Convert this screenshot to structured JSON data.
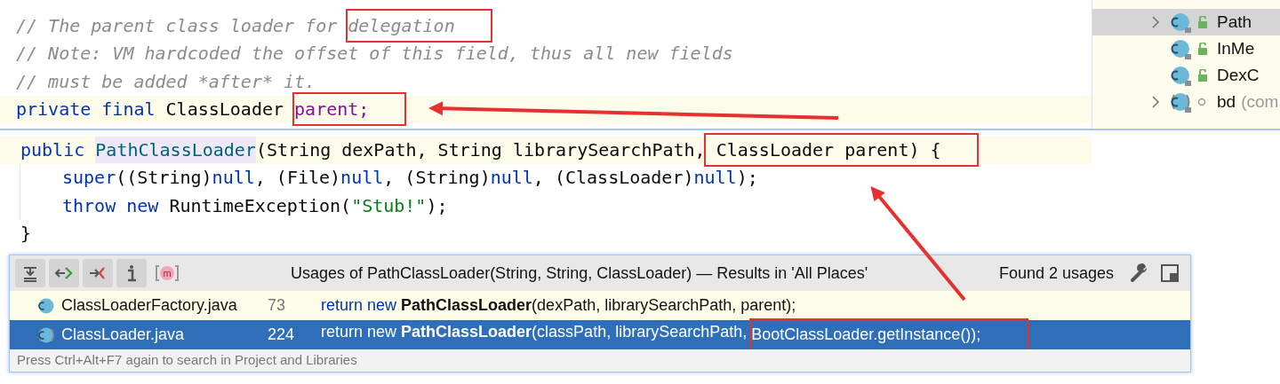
{
  "editor": {
    "lines": [
      {
        "highlighted": false,
        "segments": [
          {
            "kind": "comment",
            "text": "// The parent class loader for "
          },
          {
            "kind": "comment",
            "text": "delegation",
            "boxed": true
          }
        ]
      },
      {
        "highlighted": false,
        "segments": [
          {
            "kind": "comment",
            "text": "// Note: VM hardcoded the offset of this field, thus all new fields"
          }
        ]
      },
      {
        "highlighted": false,
        "segments": [
          {
            "kind": "comment",
            "text": "// must be added *after* it."
          }
        ]
      },
      {
        "highlighted": true,
        "segments": [
          {
            "kind": "keyword",
            "text": "private final "
          },
          {
            "kind": "plain",
            "text": "ClassLoader "
          },
          {
            "kind": "field",
            "text": "parent;",
            "boxed": true
          }
        ]
      }
    ]
  },
  "structure": {
    "items": [
      {
        "label": "Path",
        "selected": true,
        "expandable": true,
        "kind": "public"
      },
      {
        "label": "InMe",
        "selected": false,
        "expandable": false,
        "kind": "public"
      },
      {
        "label": "DexC",
        "selected": false,
        "expandable": false,
        "kind": "public"
      },
      {
        "label": "bd",
        "detail": "(com",
        "selected": false,
        "expandable": true,
        "kind": "package"
      }
    ]
  },
  "definition": {
    "lines": [
      {
        "highlighted": true,
        "segments": [
          {
            "kind": "keyword",
            "text": "public "
          },
          {
            "kind": "declaration",
            "text": "PathClassLoader"
          },
          {
            "kind": "plain",
            "text": "(String dexPath, String librarySearchPath,"
          },
          {
            "kind": "plain",
            "text": " ClassLoader parent) {",
            "boxed": true
          }
        ]
      },
      {
        "highlighted": false,
        "indented": true,
        "segments": [
          {
            "kind": "keyword",
            "text": "super"
          },
          {
            "kind": "plain",
            "text": "((String)"
          },
          {
            "kind": "keyword",
            "text": "null"
          },
          {
            "kind": "plain",
            "text": ", (File)"
          },
          {
            "kind": "keyword",
            "text": "null"
          },
          {
            "kind": "plain",
            "text": ", (String)"
          },
          {
            "kind": "keyword",
            "text": "null"
          },
          {
            "kind": "plain",
            "text": ", (ClassLoader)"
          },
          {
            "kind": "keyword",
            "text": "null"
          },
          {
            "kind": "plain",
            "text": ");"
          }
        ]
      },
      {
        "highlighted": false,
        "indented": true,
        "segments": [
          {
            "kind": "keyword",
            "text": "throw new "
          },
          {
            "kind": "plain",
            "text": "RuntimeException("
          },
          {
            "kind": "string",
            "text": "\"Stub!\""
          },
          {
            "kind": "plain",
            "text": ");"
          }
        ]
      },
      {
        "highlighted": false,
        "segments": [
          {
            "kind": "plain",
            "text": "}"
          }
        ]
      }
    ]
  },
  "usages": {
    "method_icon": "m",
    "title": "Usages of PathClassLoader(String, String, ClassLoader) — Results in 'All Places'",
    "found": "Found 2 usages",
    "rows": [
      {
        "file": "ClassLoaderFactory.java",
        "line": "73",
        "kind": "public",
        "selected": false,
        "segments": [
          {
            "kind": "keyword",
            "text": "return new "
          },
          {
            "kind": "bold",
            "text": "PathClassLoader"
          },
          {
            "kind": "plain",
            "text": "(dexPath, librarySearchPath, parent);"
          }
        ]
      },
      {
        "file": "ClassLoader.java",
        "line": "224",
        "kind": "package",
        "selected": true,
        "segments": [
          {
            "kind": "keyword",
            "text": "return new "
          },
          {
            "kind": "bold",
            "text": "PathClassLoader"
          },
          {
            "kind": "plain",
            "text": "(classPath, librarySearchPath, "
          },
          {
            "kind": "plain",
            "text": "BootClassLoader.getInstance());",
            "boxed": true
          }
        ]
      }
    ],
    "hint": "Press Ctrl+Alt+F7 again to search in Project and Libraries"
  }
}
